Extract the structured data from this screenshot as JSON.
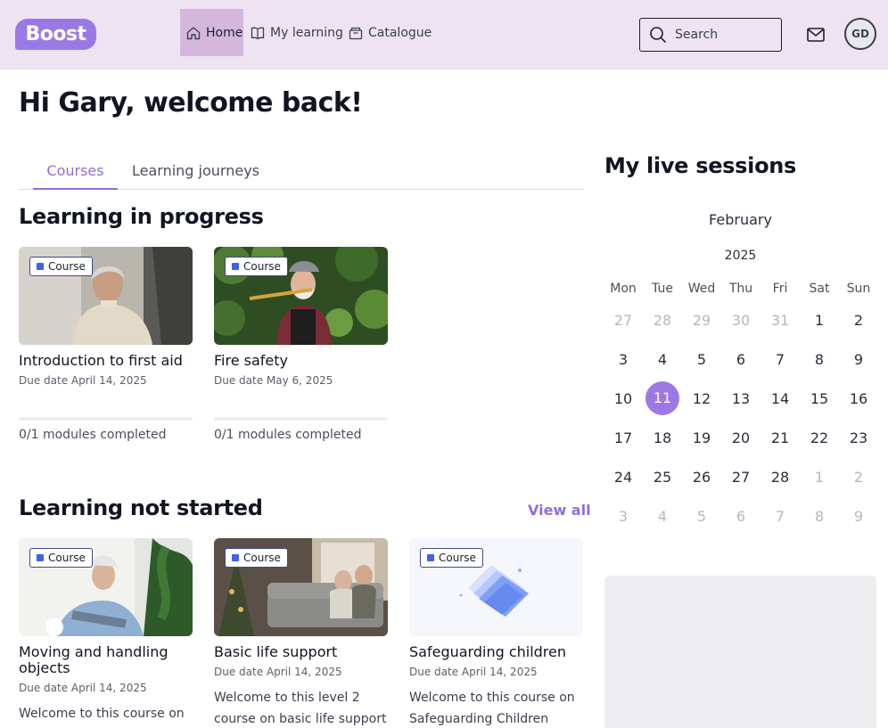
{
  "header": {
    "logo": "Boost",
    "nav": [
      {
        "label": "Home",
        "icon": "home-icon",
        "active": true
      },
      {
        "label": "My learning",
        "icon": "book-icon"
      },
      {
        "label": "Catalogue",
        "icon": "catalogue-icon"
      }
    ],
    "search_label": "Search",
    "avatar_initials": "GD"
  },
  "greeting": "Hi Gary, welcome back!",
  "tabs": [
    "Courses",
    "Learning journeys"
  ],
  "in_progress": {
    "title": "Learning in progress",
    "cards": [
      {
        "badge": "Course",
        "title": "Introduction to first aid",
        "due": "Due date April 14, 2025",
        "progress": 0,
        "modules": "0/1 modules completed"
      },
      {
        "badge": "Course",
        "title": "Fire safety",
        "due": "Due date May 6, 2025",
        "progress": 0,
        "modules": "0/1 modules completed"
      }
    ]
  },
  "not_started": {
    "title": "Learning not started",
    "view_all": "View all",
    "cards": [
      {
        "badge": "Course",
        "title": "Moving and handling objects",
        "due": "Due date April 14, 2025",
        "desc": "Welcome to this course on"
      },
      {
        "badge": "Course",
        "title": "Basic life support",
        "due": "Due date April 14, 2025",
        "desc": "Welcome to this level 2 course on basic life support"
      },
      {
        "badge": "Course",
        "title": "Safeguarding children",
        "due": "Due date April 14, 2025",
        "desc": "Welcome to this course on Safeguarding Children Level"
      }
    ]
  },
  "live_sessions": {
    "title": "My live sessions",
    "month": "February",
    "year": "2025",
    "weekdays": [
      "Mon",
      "Tue",
      "Wed",
      "Thu",
      "Fri",
      "Sat",
      "Sun"
    ],
    "weeks": [
      [
        "27",
        "28",
        "29",
        "30",
        "31",
        "1",
        "2"
      ],
      [
        "3",
        "4",
        "5",
        "6",
        "7",
        "8",
        "9"
      ],
      [
        "10",
        "11",
        "12",
        "13",
        "14",
        "15",
        "16"
      ],
      [
        "17",
        "18",
        "19",
        "20",
        "21",
        "22",
        "23"
      ],
      [
        "24",
        "25",
        "26",
        "27",
        "28",
        "1",
        "2"
      ],
      [
        "3",
        "4",
        "5",
        "6",
        "7",
        "8",
        "9"
      ]
    ],
    "selected_day": "11"
  },
  "colors": {
    "accent": "#9b79e5",
    "header_bg": "#ede3f1",
    "badge_square": "#3f62e8"
  }
}
